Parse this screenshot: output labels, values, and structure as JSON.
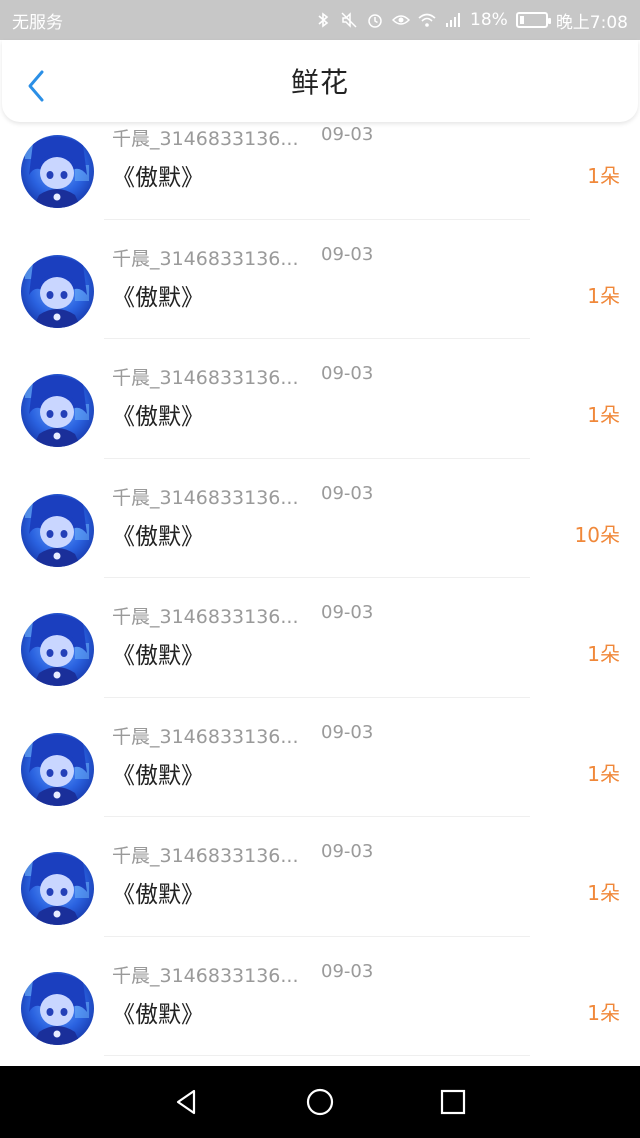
{
  "status_bar": {
    "carrier": "无服务",
    "battery_percent": "18%",
    "time": "晚上7:08",
    "battery_level": 0.18,
    "icons": [
      "bluetooth-icon",
      "mute-icon",
      "alarm-icon",
      "eye-icon",
      "wifi-icon",
      "signal-icon",
      "battery-icon"
    ]
  },
  "nav": {
    "title": "鲜花",
    "back_icon": "chevron-left-icon"
  },
  "colors": {
    "accent": "#2b8fe6",
    "count": "#f0883a",
    "muted_text": "#9a9a9a",
    "status_bar_bg": "#c7c7c7"
  },
  "items": [
    {
      "user": "千晨_3146833136...",
      "date": "09-03",
      "book": "《傲默》",
      "count": "1朵"
    },
    {
      "user": "千晨_3146833136...",
      "date": "09-03",
      "book": "《傲默》",
      "count": "1朵"
    },
    {
      "user": "千晨_3146833136...",
      "date": "09-03",
      "book": "《傲默》",
      "count": "1朵"
    },
    {
      "user": "千晨_3146833136...",
      "date": "09-03",
      "book": "《傲默》",
      "count": "10朵"
    },
    {
      "user": "千晨_3146833136...",
      "date": "09-03",
      "book": "《傲默》",
      "count": "1朵"
    },
    {
      "user": "千晨_3146833136...",
      "date": "09-03",
      "book": "《傲默》",
      "count": "1朵"
    },
    {
      "user": "千晨_3146833136...",
      "date": "09-03",
      "book": "《傲默》",
      "count": "1朵"
    },
    {
      "user": "千晨_3146833136...",
      "date": "09-03",
      "book": "《傲默》",
      "count": "1朵"
    }
  ],
  "system_nav": {
    "buttons": [
      "back-triangle-icon",
      "home-circle-icon",
      "recents-square-icon"
    ]
  }
}
